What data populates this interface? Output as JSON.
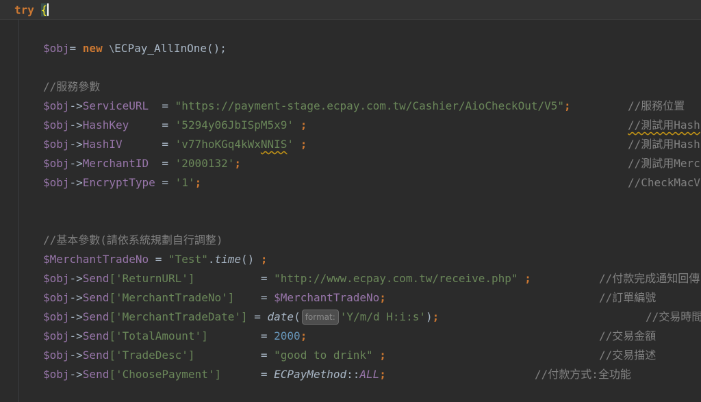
{
  "editor": {
    "line_try": {
      "kw": "try",
      "brace": "{"
    },
    "line_obj_new": {
      "var": "$obj",
      "op": "= ",
      "kw": "new",
      "sep": " ",
      "cls": "ECPay_AllInOne",
      "rest": "();"
    },
    "comment_service": "//服務參數",
    "service_url": {
      "var": "$obj",
      "arrow": "->",
      "prop": "ServiceURL",
      "pad": "  = ",
      "val": "\"https://payment-stage.ecpay.com.tw/Cashier/AioCheckOut/V5\"",
      "semi": ";",
      "cmt": "//服務位置"
    },
    "hash_key": {
      "var": "$obj",
      "arrow": "->",
      "prop": "HashKey",
      "pad": "     = ",
      "val": "'5294y06JbISpM5x9'",
      "semi": " ;",
      "cmt": "//測試用Hash"
    },
    "hash_iv": {
      "var": "$obj",
      "arrow": "->",
      "prop": "HashIV",
      "pad": "      = ",
      "val_a": "'v77hoKGq4kWx",
      "val_b": "NNIS",
      "val_c": "'",
      "semi": " ;",
      "cmt": "//測試用Hash"
    },
    "merchant_id": {
      "var": "$obj",
      "arrow": "->",
      "prop": "MerchantID",
      "pad": "  = ",
      "val": "'2000132'",
      "semi": ";",
      "cmt": "//測試用Merc"
    },
    "encrypt_type": {
      "var": "$obj",
      "arrow": "->",
      "prop": "EncryptType",
      "pad": " = ",
      "val": "'1'",
      "semi": ";",
      "cmt": "//CheckMacV"
    },
    "comment_basic": "//基本參數(請依系統規劃自行調整)",
    "trade_no_line": {
      "var": "$MerchantTradeNo",
      "op": " = ",
      "val": "\"Test\"",
      "dot": ".",
      "fn": "time",
      "rest": "() ",
      "semi": ";"
    },
    "send_rows": [
      {
        "var": "$obj",
        "arrow": "->",
        "send": "Send",
        "key": "['ReturnURL']",
        "pad": "          = ",
        "val": "\"http://www.ecpay.com.tw/receive.php\"",
        "semi": " ;",
        "cmt": "//付款完成通知回傳"
      },
      {
        "var": "$obj",
        "arrow": "->",
        "send": "Send",
        "key": "['MerchantTradeNo']",
        "pad": "    = ",
        "val": "$MerchantTradeNo",
        "semi": ";",
        "cmt": "//訂單編號"
      },
      {
        "var": "$obj",
        "arrow": "->",
        "send": "Send",
        "key": "['MerchantTradeDate']",
        "pad": " = ",
        "fn": "date",
        "paren_open": "(",
        "hint": "format:",
        "val": "'Y/m/d H:i:s'",
        "paren_close": ")",
        "semi": ";",
        "cmt": "//交易時間"
      },
      {
        "var": "$obj",
        "arrow": "->",
        "send": "Send",
        "key": "['TotalAmount']",
        "pad": "        = ",
        "val": "2000",
        "semi": ";",
        "cmt": "//交易金額"
      },
      {
        "var": "$obj",
        "arrow": "->",
        "send": "Send",
        "key": "['TradeDesc']",
        "pad": "          = ",
        "val": "\"good to drink\"",
        "semi": " ;",
        "cmt": "//交易描述"
      },
      {
        "var": "$obj",
        "arrow": "->",
        "send": "Send",
        "key": "['ChoosePayment']",
        "pad": "      = ",
        "cls": "ECPayMethod",
        "dc": "::",
        "const": "ALL",
        "semi": ";",
        "cmt": "//付款方式:全功能"
      }
    ],
    "ns_icon": "namespace-backslash-icon",
    "colors": {
      "background": "#2b2b2b",
      "keyword": "#cc7832",
      "variable": "#9876aa",
      "string": "#6a8759",
      "number": "#6897bb",
      "comment": "#808080"
    }
  }
}
